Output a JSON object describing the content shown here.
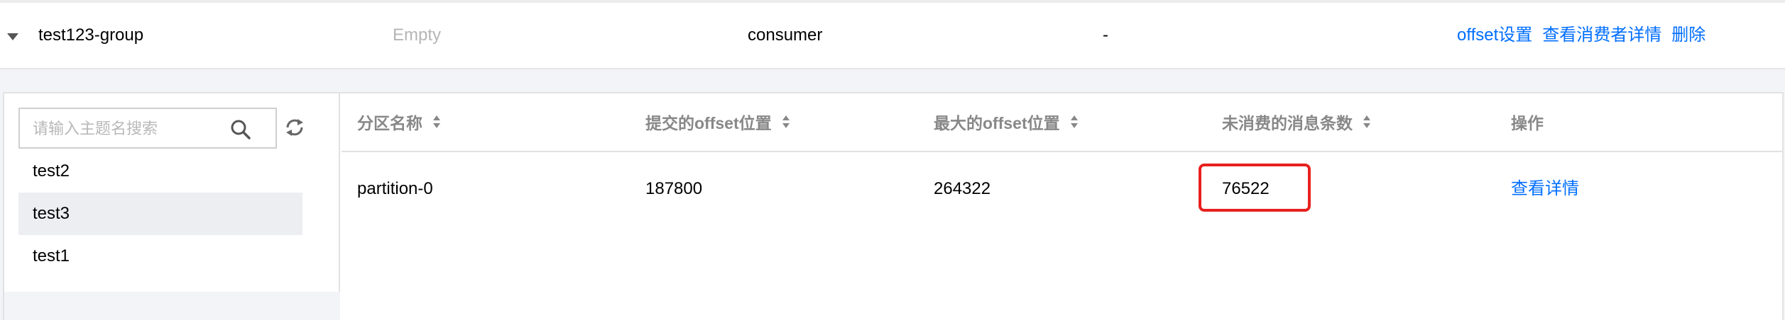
{
  "group_row": {
    "name": "test123-group",
    "state": "Empty",
    "protocol": "consumer",
    "extra": "-",
    "actions": {
      "offset": "offset设置",
      "details": "查看消费者详情",
      "delete": "删除"
    }
  },
  "sidebar": {
    "search_placeholder": "请输入主题名搜索",
    "topics": [
      {
        "label": "test2",
        "active": false
      },
      {
        "label": "test3",
        "active": true
      },
      {
        "label": "test1",
        "active": false
      }
    ]
  },
  "table": {
    "columns": [
      "分区名称",
      "提交的offset位置",
      "最大的offset位置",
      "未消费的消息条数",
      "操作"
    ],
    "rows": [
      {
        "partition": "partition-0",
        "committed_offset": "187800",
        "max_offset": "264322",
        "unconsumed": "76522",
        "action": "查看详情"
      }
    ]
  },
  "colors": {
    "link": "#006eff",
    "highlight": "#e8201e",
    "muted": "#b5b5b5"
  }
}
